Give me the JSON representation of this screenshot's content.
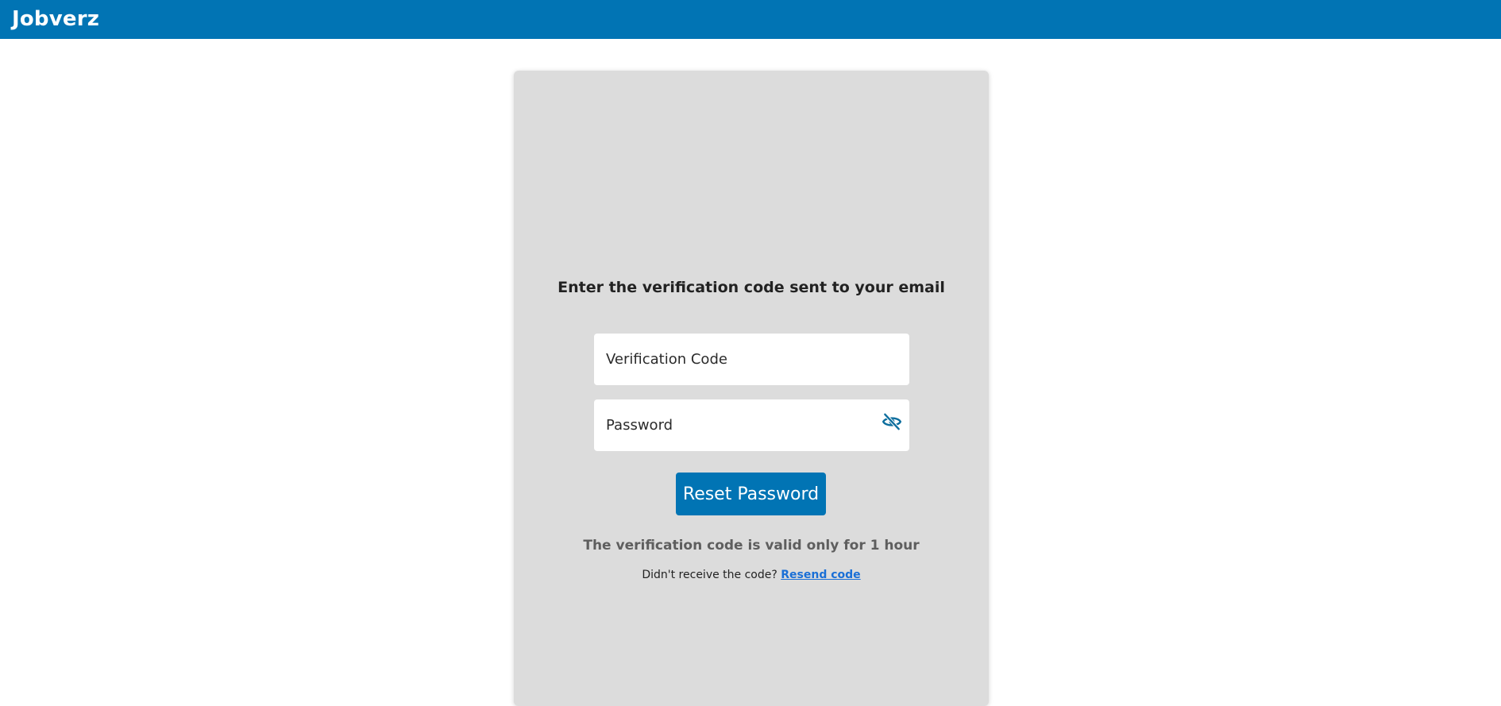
{
  "header": {
    "brand": "Jobverz",
    "bg_color": "#0174b4"
  },
  "form": {
    "heading": "Enter the verification code sent to your email",
    "code_field": {
      "placeholder": "Verification Code",
      "value": ""
    },
    "password_field": {
      "placeholder": "Password",
      "value": "",
      "toggle_icon": "eye-slash-icon"
    },
    "submit_label": "Reset Password",
    "validity_note": "The verification code is valid only for 1 hour",
    "resend_prompt": "Didn't receive the code?",
    "resend_link": "Resend code",
    "card_color": "#dcdcdc",
    "accent_color": "#0174b4",
    "link_color": "#1a6fd6"
  }
}
